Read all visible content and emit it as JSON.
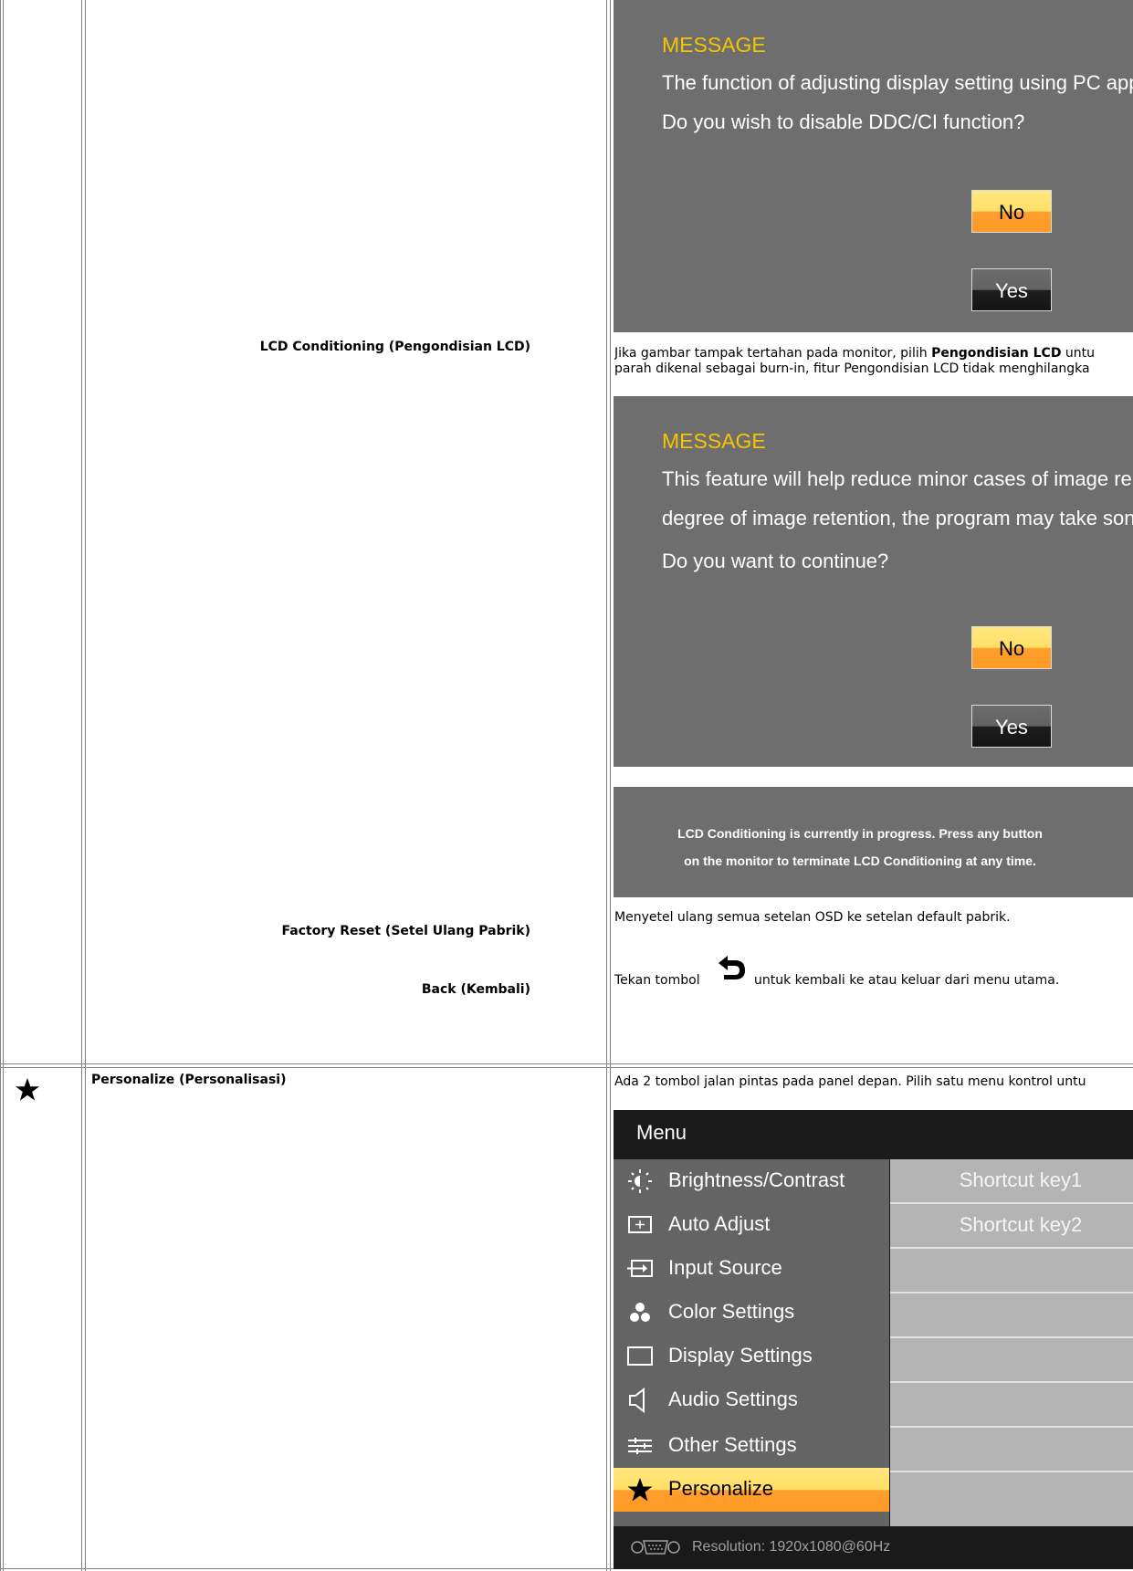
{
  "rows": {
    "lcd_conditioning": {
      "label": "LCD Conditioning (Pengondisian LCD)",
      "desc_pre": "Jika gambar tampak tertahan pada monitor, pilih ",
      "desc_bold": "Pengondisian LCD",
      "desc_post": " untu",
      "desc_line2": "parah dikenal sebagai burn-in, fitur Pengondisian LCD tidak menghilangka"
    },
    "factory_reset": {
      "label": "Factory Reset (Setel Ulang Pabrik)",
      "desc": "Menyetel ulang semua setelan OSD ke setelan default pabrik."
    },
    "back": {
      "label": "Back (Kembali)",
      "desc_pre": "Tekan tombol",
      "desc_post": "untuk kembali ke atau keluar dari menu utama."
    },
    "personalize": {
      "label": "Personalize (Personalisasi)",
      "desc": "Ada 2 tombol jalan pintas pada panel depan. Pilih satu menu kontrol untu"
    }
  },
  "dialog_ddc": {
    "title": "MESSAGE",
    "line1": "The function of adjusting display setting using PC app",
    "line2": "Do you wish to disable DDC/CI function?",
    "no": "No",
    "yes": "Yes"
  },
  "dialog_lcd": {
    "title": "MESSAGE",
    "line1": "This feature will help reduce minor cases of image re",
    "line2": "degree of image retention, the program may take son",
    "line3": "Do you want to continue?",
    "no": "No",
    "yes": "Yes"
  },
  "progress": {
    "line1": "LCD Conditioning is currently in progress. Press any button",
    "line2": "on the monitor to terminate LCD Conditioning at any time."
  },
  "osd_menu": {
    "title": "Menu",
    "items": [
      {
        "label": "Brightness/Contrast",
        "icon": "brightness-icon"
      },
      {
        "label": "Auto Adjust",
        "icon": "auto-adjust-icon"
      },
      {
        "label": "Input Source",
        "icon": "input-source-icon"
      },
      {
        "label": "Color Settings",
        "icon": "color-settings-icon"
      },
      {
        "label": "Display Settings",
        "icon": "display-settings-icon"
      },
      {
        "label": "Audio Settings",
        "icon": "audio-settings-icon"
      },
      {
        "label": "Other Settings",
        "icon": "other-settings-icon"
      },
      {
        "label": "Personalize",
        "icon": "star-icon"
      }
    ],
    "right": [
      "Shortcut key1",
      "Shortcut key2",
      "",
      "",
      "",
      "",
      "",
      ""
    ],
    "resolution": "Resolution:  1920x1080@60Hz",
    "selected_index": 7
  },
  "icons": {
    "row_icon": "star-icon",
    "back_icon": "back-arrow-icon"
  },
  "colors": {
    "dialog_bg": "#6e6e6e",
    "title_yellow": "#f7c400",
    "highlight_orange": "#ff9f2e",
    "highlight_yellow": "#ffe066"
  }
}
